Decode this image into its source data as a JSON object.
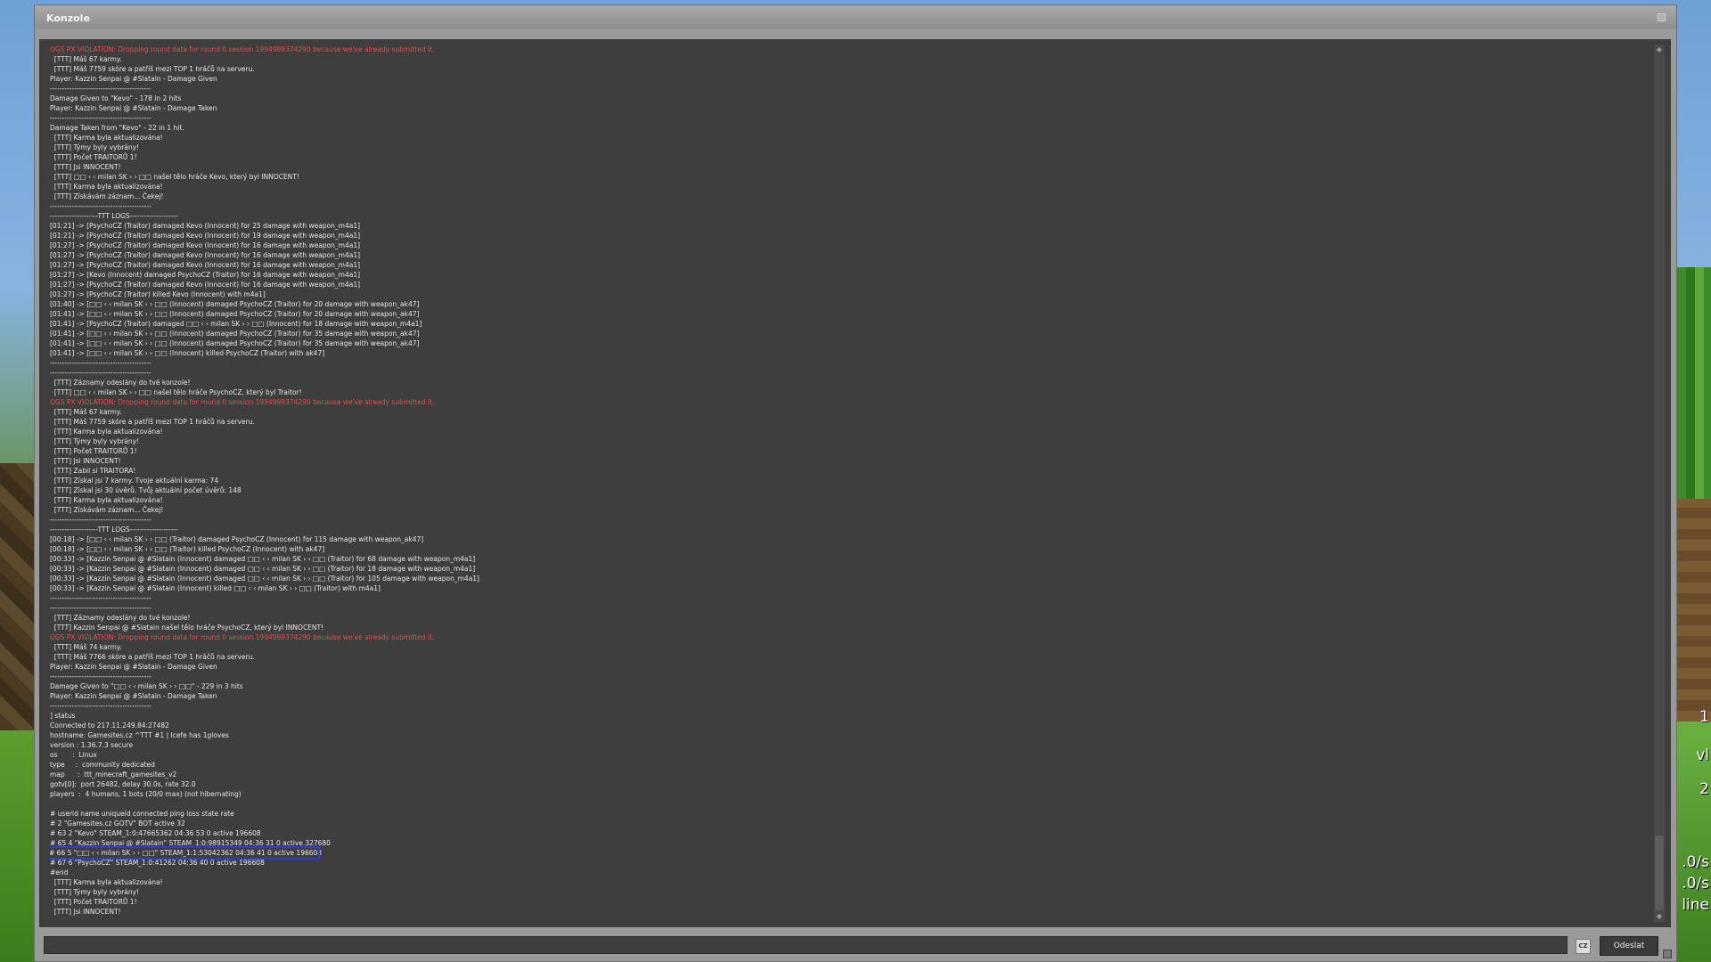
{
  "window": {
    "title": "Konzole",
    "send_label": "Odeslat",
    "lang_badge": "CZ",
    "input_value": "",
    "close_icon": "close-icon",
    "resize_icon": "resize-grip-icon"
  },
  "colors": {
    "panel_bg": "#3e3e3e",
    "text": "#e6e6e6",
    "warning_text": "#e0504d",
    "highlight_box": "#2b3dd6"
  },
  "hud": [
    "1",
    "vl",
    "2",
    ".0/s",
    ".0/s",
    "line"
  ],
  "console": {
    "lines": [
      {
        "text": "OGS PX VIOLATION: Dropping round data for round 0 session 1994989374290 because we've already submitted it.",
        "type": "warn"
      },
      {
        "text": "  [TTT] Máš 67 karmy.",
        "type": "info"
      },
      {
        "text": "  [TTT] Máš 7759 skóre a patříš mezi TOP 1 hráčů na serveru.",
        "type": "info"
      },
      {
        "text": "Player: Kazzin Senpai @ #Slatain - Damage Given",
        "type": "info"
      },
      {
        "text": "------------------------------------------",
        "type": "info"
      },
      {
        "text": "Damage Given to \"Kevo\" - 178 in 2 hits",
        "type": "info"
      },
      {
        "text": "Player: Kazzin Senpai @ #Slatain - Damage Taken",
        "type": "info"
      },
      {
        "text": "------------------------------------------",
        "type": "info"
      },
      {
        "text": "Damage Taken from \"Kevo\" - 22 in 1 hit.",
        "type": "info"
      },
      {
        "text": "  [TTT] Karma byla aktualizována!",
        "type": "info"
      },
      {
        "text": "  [TTT] Týmy byly vybrány!",
        "type": "info"
      },
      {
        "text": "  [TTT] Počet TRAITORŮ 1!",
        "type": "info"
      },
      {
        "text": "  [TTT] Jsi INNOCENT!",
        "type": "info"
      },
      {
        "text": "  [TTT] □□ ‹ ‹ milan SK › › □□ našel tělo hráče Kevo, který byl INNOCENT!",
        "type": "info"
      },
      {
        "text": "  [TTT] Karma byla aktualizována!",
        "type": "info"
      },
      {
        "text": "  [TTT] Získávám záznam... Čekej!",
        "type": "info"
      },
      {
        "text": "------------------------------------------",
        "type": "info"
      },
      {
        "text": "--------------------TTT LOGS--------------------",
        "type": "info"
      },
      {
        "text": "[01:21] -> [PsychoCZ (Traitor) damaged Kevo (Innocent) for 25 damage with weapon_m4a1]",
        "type": "info"
      },
      {
        "text": "[01:21] -> [PsychoCZ (Traitor) damaged Kevo (Innocent) for 19 damage with weapon_m4a1]",
        "type": "info"
      },
      {
        "text": "[01:27] -> [PsychoCZ (Traitor) damaged Kevo (Innocent) for 16 damage with weapon_m4a1]",
        "type": "info"
      },
      {
        "text": "[01:27] -> [PsychoCZ (Traitor) damaged Kevo (Innocent) for 16 damage with weapon_m4a1]",
        "type": "info"
      },
      {
        "text": "[01:27] -> [PsychoCZ (Traitor) damaged Kevo (Innocent) for 16 damage with weapon_m4a1]",
        "type": "info"
      },
      {
        "text": "[01:27] -> [Kevo (Innocent) damaged PsychoCZ (Traitor) for 16 damage with weapon_m4a1]",
        "type": "info"
      },
      {
        "text": "[01:27] -> [PsychoCZ (Traitor) damaged Kevo (Innocent) for 16 damage with weapon_m4a1]",
        "type": "info"
      },
      {
        "text": "[01:27] -> [PsychoCZ (Traitor) killed Kevo (Innocent) with m4a1]",
        "type": "info"
      },
      {
        "text": "[01:40] -> [□□ ‹ ‹ milan SK › › □□ (Innocent) damaged PsychoCZ (Traitor) for 20 damage with weapon_ak47]",
        "type": "info"
      },
      {
        "text": "[01:41] -> [□□ ‹ ‹ milan SK › › □□ (Innocent) damaged PsychoCZ (Traitor) for 20 damage with weapon_ak47]",
        "type": "info"
      },
      {
        "text": "[01:41] -> [PsychoCZ (Traitor) damaged □□ ‹ ‹ milan SK › › □□ (Innocent) for 18 damage with weapon_m4a1]",
        "type": "info"
      },
      {
        "text": "[01:41] -> [□□ ‹ ‹ milan SK › › □□ (Innocent) damaged PsychoCZ (Traitor) for 35 damage with weapon_ak47]",
        "type": "info"
      },
      {
        "text": "[01:41] -> [□□ ‹ ‹ milan SK › › □□ (Innocent) damaged PsychoCZ (Traitor) for 35 damage with weapon_ak47]",
        "type": "info"
      },
      {
        "text": "[01:41] -> [□□ ‹ ‹ milan SK › › □□ (Innocent) killed PsychoCZ (Traitor) with ak47]",
        "type": "info"
      },
      {
        "text": "------------------------------------------",
        "type": "info"
      },
      {
        "text": "------------------------------------------",
        "type": "info"
      },
      {
        "text": "  [TTT] Záznamy odeslány do tvé konzole!",
        "type": "info"
      },
      {
        "text": "  [TTT] □□ ‹ ‹ milan SK › › □□ našel tělo hráče PsychoCZ, který byl Traitor!",
        "type": "info"
      },
      {
        "text": "OGS PX VIOLATION: Dropping round data for round 0 session 1994989374290 because we've already submitted it.",
        "type": "warn"
      },
      {
        "text": "  [TTT] Máš 67 karmy.",
        "type": "info"
      },
      {
        "text": "  [TTT] Máš 7759 skóre a patříš mezi TOP 1 hráčů na serveru.",
        "type": "info"
      },
      {
        "text": "  [TTT] Karma byla aktualizována!",
        "type": "info"
      },
      {
        "text": "  [TTT] Týmy byly vybrány!",
        "type": "info"
      },
      {
        "text": "  [TTT] Počet TRAITORŮ 1!",
        "type": "info"
      },
      {
        "text": "  [TTT] Jsi INNOCENT!",
        "type": "info"
      },
      {
        "text": "  [TTT] Zabil si TRAITORA!",
        "type": "info"
      },
      {
        "text": "  [TTT] Získal jsi 7 karmy. Tvoje aktuální karma: 74",
        "type": "info"
      },
      {
        "text": "  [TTT] Získal jsi 30 úvěrů. Tvůj aktuální počet úvěrů: 148",
        "type": "info"
      },
      {
        "text": "  [TTT] Karma byla aktualizována!",
        "type": "info"
      },
      {
        "text": "  [TTT] Získávám záznam... Čekej!",
        "type": "info"
      },
      {
        "text": "------------------------------------------",
        "type": "info"
      },
      {
        "text": "--------------------TTT LOGS--------------------",
        "type": "info"
      },
      {
        "text": "[00:18] -> [□□ ‹ ‹ milan SK › › □□ (Traitor) damaged PsychoCZ (Innocent) for 115 damage with weapon_ak47]",
        "type": "info"
      },
      {
        "text": "[00:18] -> [□□ ‹ ‹ milan SK › › □□ (Traitor) killed PsychoCZ (Innocent) with ak47]",
        "type": "info"
      },
      {
        "text": "[00:33] -> [Kazzin Senpai @ #Slatain (Innocent) damaged □□ ‹ ‹ milan SK › › □□ (Traitor) for 68 damage with weapon_m4a1]",
        "type": "info"
      },
      {
        "text": "[00:33] -> [Kazzin Senpai @ #Slatain (Innocent) damaged □□ ‹ ‹ milan SK › › □□ (Traitor) for 18 damage with weapon_m4a1]",
        "type": "info"
      },
      {
        "text": "[00:33] -> [Kazzin Senpai @ #Slatain (Innocent) damaged □□ ‹ ‹ milan SK › › □□ (Traitor) for 105 damage with weapon_m4a1]",
        "type": "info"
      },
      {
        "text": "[00:33] -> [Kazzin Senpai @ #Slatain (Innocent) killed □□ ‹ ‹ milan SK › › □□ (Traitor) with m4a1]",
        "type": "info"
      },
      {
        "text": "------------------------------------------",
        "type": "info"
      },
      {
        "text": "------------------------------------------",
        "type": "info"
      },
      {
        "text": "  [TTT] Záznamy odeslány do tvé konzole!",
        "type": "info"
      },
      {
        "text": "  [TTT] Kazzin Senpai @ #Slatain našel tělo hráče PsychoCZ, který byl INNOCENT!",
        "type": "info"
      },
      {
        "text": "OGS PX VIOLATION: Dropping round data for round 0 session 1994989374290 because we've already submitted it.",
        "type": "warn"
      },
      {
        "text": "  [TTT] Máš 74 karmy.",
        "type": "info"
      },
      {
        "text": "  [TTT] Máš 7766 skóre a patříš mezi TOP 1 hráčů na serveru.",
        "type": "info"
      },
      {
        "text": "Player: Kazzin Senpai @ #Slatain - Damage Given",
        "type": "info"
      },
      {
        "text": "------------------------------------------",
        "type": "info"
      },
      {
        "text": "Damage Given to \"□□ ‹ ‹ milan SK › › □□\" - 229 in 3 hits",
        "type": "info"
      },
      {
        "text": "Player: Kazzin Senpai @ #Slatain - Damage Taken",
        "type": "info"
      },
      {
        "text": "------------------------------------------",
        "type": "info"
      },
      {
        "text": "] status",
        "type": "info"
      },
      {
        "text": "Connected to 217.11.249.84:27482",
        "type": "info"
      },
      {
        "text": "hostname: Gamesites.cz ^TTT #1 | Icefe has 1gloves",
        "type": "info"
      },
      {
        "text": "version : 1.36.7.3 secure",
        "type": "info"
      },
      {
        "text": "os       :  Linux",
        "type": "info"
      },
      {
        "text": "type     :  community dedicated",
        "type": "info"
      },
      {
        "text": "map      :  ttt_minecraft_gamesites_v2",
        "type": "info"
      },
      {
        "text": "gotv[0]:  port 26482, delay 30.0s, rate 32.0",
        "type": "info"
      },
      {
        "text": "players  :  4 humans, 1 bots (20/0 max) (not hibernating)",
        "type": "info"
      },
      {
        "text": "",
        "type": "info"
      },
      {
        "text": "# userid name uniqueid connected ping loss state rate",
        "type": "info"
      },
      {
        "text": "# 2 \"Gamesites.cz GOTV\" BOT active 32",
        "type": "info"
      },
      {
        "text": "# 63 2 \"Kevo\" STEAM_1:0:47665362 04:36 53 0 active 196608",
        "type": "info"
      },
      {
        "text": "# 65 4 \"Kazzin Senpai @ #Slatain\" STEAM_1:0:98915349 04:36 31 0 active 327680",
        "type": "info"
      },
      {
        "text": "# 66 5 \"□□ ‹ ‹ milan SK › › □□\" STEAM_1:1:53042362 04:36 41 0 active 196608",
        "type": "highlight"
      },
      {
        "text": "# 67 6 \"PsychoCZ\" STEAM_1:0:41262 04:36 40 0 active 196608",
        "type": "info"
      },
      {
        "text": "#end",
        "type": "info"
      },
      {
        "text": "  [TTT] Karma byla aktualizována!",
        "type": "info"
      },
      {
        "text": "  [TTT] Týmy byly vybrány!",
        "type": "info"
      },
      {
        "text": "  [TTT] Počet TRAITORŮ 1!",
        "type": "info"
      },
      {
        "text": "  [TTT] Jsi INNOCENT!",
        "type": "info"
      }
    ]
  }
}
